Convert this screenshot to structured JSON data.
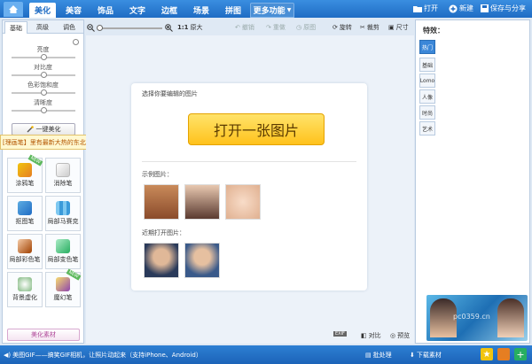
{
  "nav": {
    "tabs": [
      {
        "label": "美化",
        "active": true
      },
      {
        "label": "美容"
      },
      {
        "label": "饰品"
      },
      {
        "label": "文字"
      },
      {
        "label": "边框"
      },
      {
        "label": "场景"
      },
      {
        "label": "拼图"
      },
      {
        "label": "更多功能"
      }
    ],
    "open": "打开",
    "new": "新建",
    "save_share": "保存与分享"
  },
  "left": {
    "subtabs": [
      "基础",
      "高级",
      "调色"
    ],
    "sliders": [
      {
        "label": "亮度",
        "value": 0.5
      },
      {
        "label": "对比度",
        "value": 0.5
      },
      {
        "label": "色彩饱和度",
        "value": 0.5
      },
      {
        "label": "清晰度",
        "value": 0.5
      }
    ],
    "one_click": "一键美化",
    "tooltip": "[理画笔】里有最新大热的东北大花素材哦，快来试试!",
    "tools": [
      "涂鸦笔",
      "消除笔",
      "抠图笔",
      "局部马赛克",
      "局部彩色笔",
      "局部变色笔",
      "背景虚化",
      "魔幻笔"
    ],
    "badge_new": "NEW",
    "material": "美化素材"
  },
  "toolbar": {
    "zoom_label": "1:1",
    "original": "原大",
    "undo": "撤销",
    "redo": "重做",
    "restore": "原图",
    "rotate": "旋转",
    "crop": "裁剪",
    "size": "尺寸"
  },
  "canvas": {
    "prompt": "选择你要编辑的图片",
    "open_button": "打开一张图片",
    "examples_label": "示例图片：",
    "recent_label": "近期打开图片："
  },
  "effects": {
    "title": "特效：",
    "tabs": [
      "热门",
      "基础",
      "Lomo",
      "人像",
      "时尚",
      "艺术"
    ]
  },
  "bottom": {
    "tips": "美图GIF——搞笑GIF相机，让照片动起来（支持iPhone、Android）",
    "compare": "对比",
    "preview": "预览",
    "batch": "批处理",
    "download": "下载素材",
    "watermark": "pc0359.cn",
    "colors": {
      "accent": "#1f6cc4",
      "button": "#ffc21c"
    }
  }
}
